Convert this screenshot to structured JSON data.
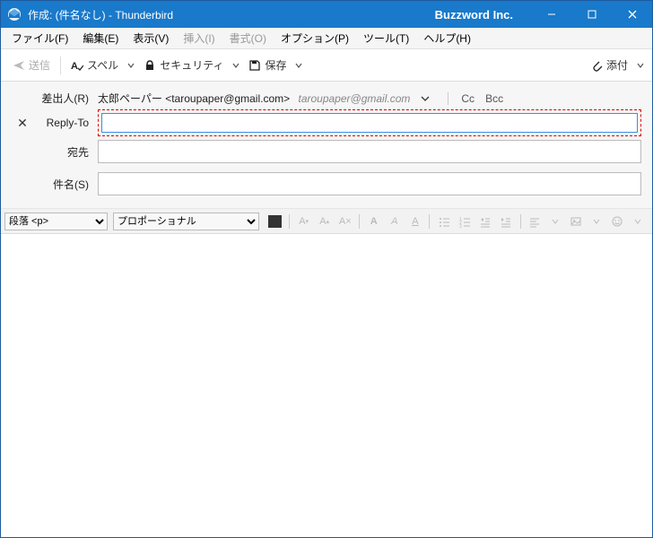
{
  "title": "作成: (件名なし) - Thunderbird",
  "brand": "Buzzword Inc.",
  "menu": {
    "file": "ファイル(F)",
    "edit": "編集(E)",
    "view": "表示(V)",
    "insert": "挿入(I)",
    "format": "書式(O)",
    "options": "オプション(P)",
    "tools": "ツール(T)",
    "help": "ヘルプ(H)"
  },
  "toolbar": {
    "send": "送信",
    "spell": "スペル",
    "security": "セキュリティ",
    "save": "保存",
    "attach": "添付"
  },
  "addr": {
    "from_label": "差出人(R)",
    "from_value": "太郎ペーパー <taroupaper@gmail.com>",
    "from_hint": "taroupaper@gmail.com",
    "cc": "Cc",
    "bcc": "Bcc",
    "replyto_label": "Reply-To",
    "replyto_value": "",
    "to_label": "宛先",
    "to_value": "",
    "subject_label": "件名(S)",
    "subject_value": ""
  },
  "fmt": {
    "block_label": "段落 <p>",
    "font_label": "プロポーショナル"
  }
}
